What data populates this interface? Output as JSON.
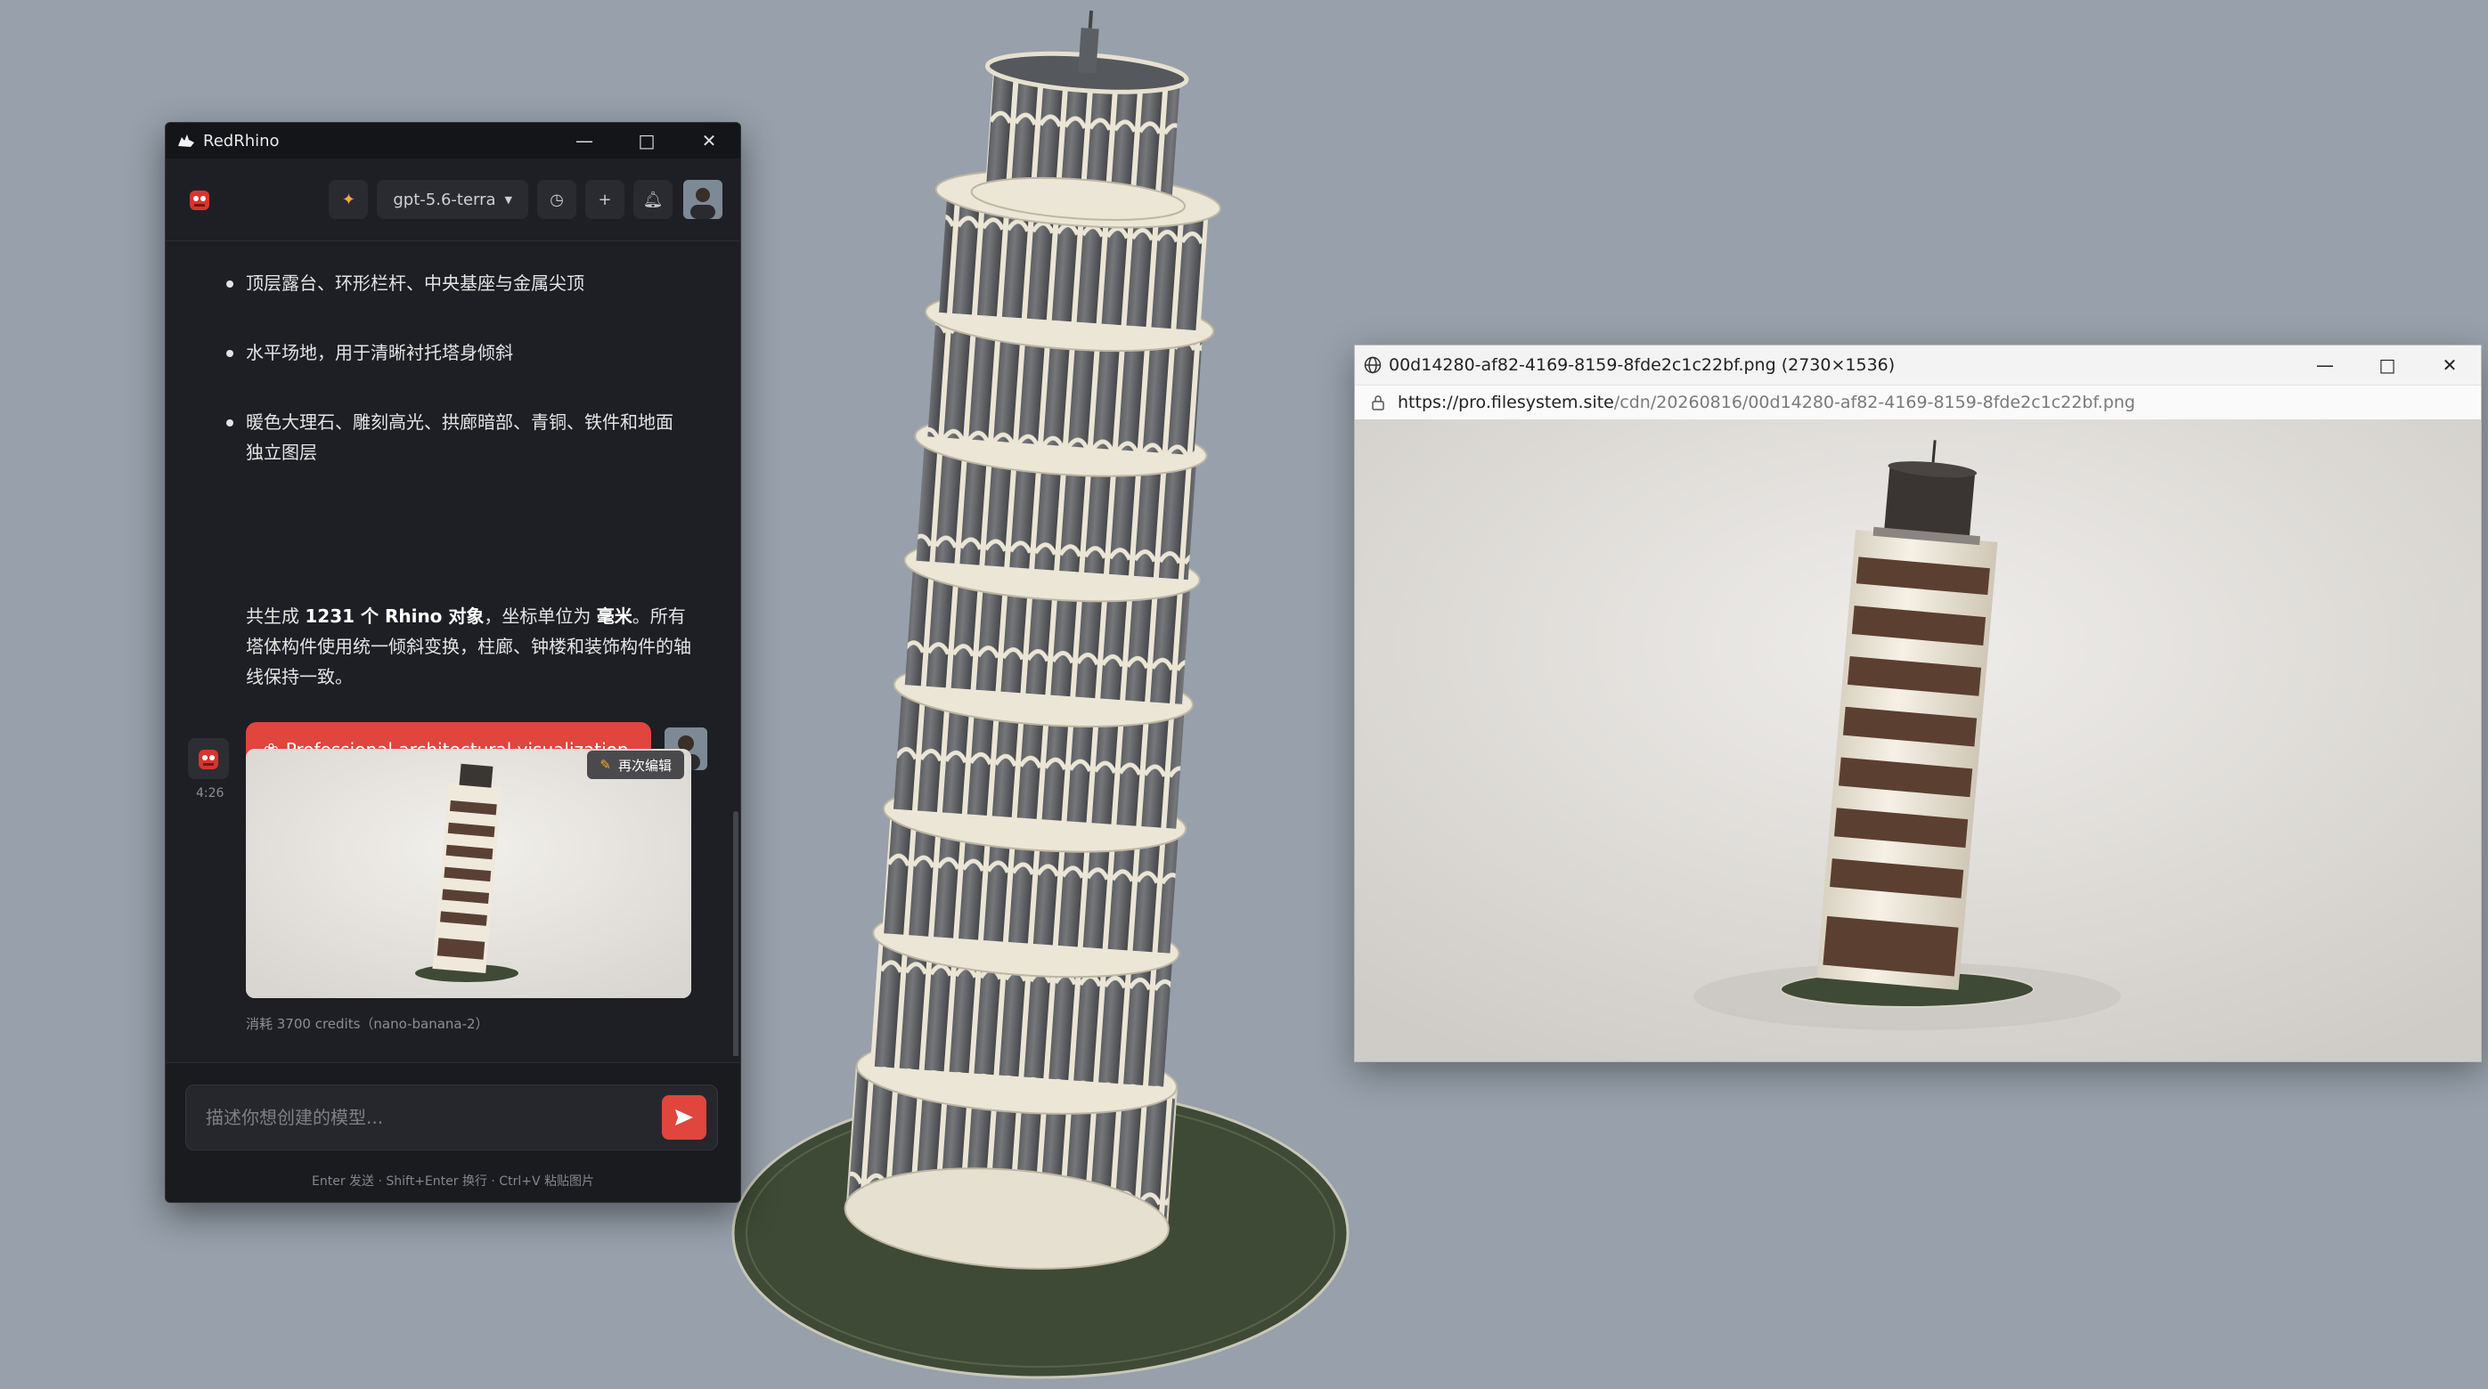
{
  "app": {
    "title": "RedRhino",
    "model": "gpt-5.6-terra"
  },
  "chat": {
    "bullets": [
      "顶层露台、环形栏杆、中央基座与金属尖顶",
      "水平场地，用于清晰衬托塔身倾斜",
      "暖色大理石、雕刻高光、拱廊暗部、青铜、铁件和地面独立图层"
    ],
    "summary": {
      "prefix": "共生成 ",
      "count_bold": "1231 个 Rhino 对象",
      "mid": "，坐标单位为 ",
      "unit_bold": "毫米",
      "suffix": "。所有塔体构件使用统一倾斜变换，柱廊、钟楼和装饰构件的轴线保持一致。"
    },
    "user_prompt": "Professional architectural visualization with clean materials and neutral lighting",
    "bot_time": "4:26",
    "edit_label": "再次编辑",
    "credits": "消耗 3700 credits（nano-banana-2）",
    "input_placeholder": "描述你想创建的模型...",
    "hint": "Enter 发送 · Shift+Enter 换行 · Ctrl+V 粘贴图片"
  },
  "viewer": {
    "title": "00d14280-af82-4169-8159-8fde2c1c22bf.png (2730×1536)",
    "url_host": "https://pro.filesystem.site",
    "url_path": "/cdn/20260816/00d14280-af82-4169-8159-8fde2c1c22bf.png"
  },
  "colors": {
    "accent": "#e0453e",
    "chat_bg": "#1e1f24",
    "desktop_bg": "#97a0ab",
    "marble": "#e8e2d2",
    "ground_disc": "#3e4a35"
  },
  "icons": [
    "rhino-logo-icon",
    "minimize-icon",
    "maximize-icon",
    "close-icon",
    "sparkle-icon",
    "chevron-down-icon",
    "history-icon",
    "plus-icon",
    "bell-icon",
    "palette-icon",
    "pencil-icon",
    "send-icon",
    "globe-icon",
    "lock-icon"
  ]
}
